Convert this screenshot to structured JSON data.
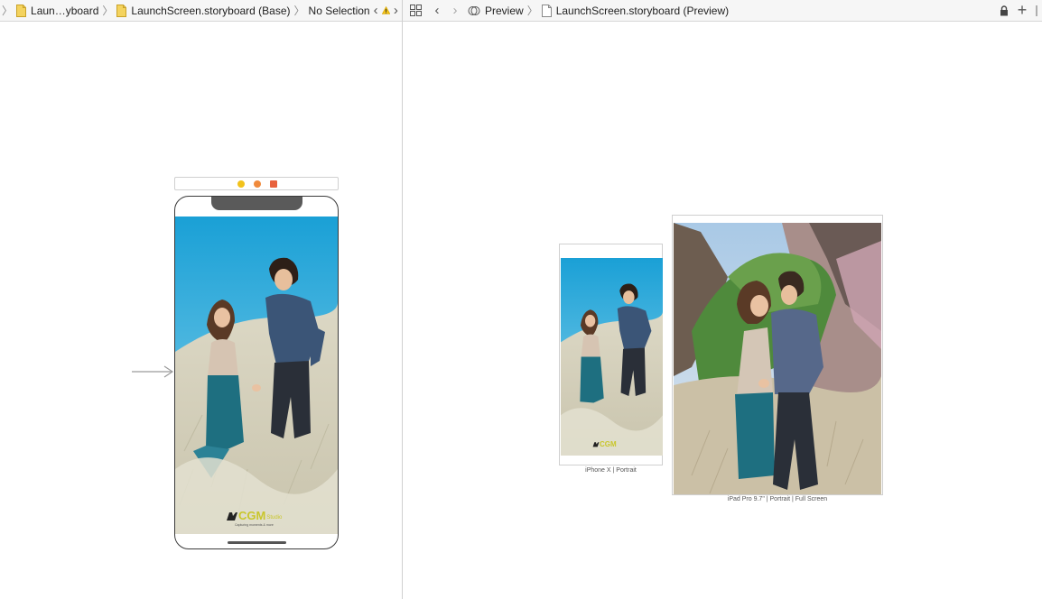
{
  "left_jumpbar": {
    "crumb1": "Laun…yboard",
    "crumb2": "LaunchScreen.storyboard (Base)",
    "crumb3": "No Selection",
    "warning_icon": "warning-triangle-icon",
    "warning_color": "#f2c21b"
  },
  "right_jumpbar": {
    "crumb1": "Preview",
    "crumb2": "LaunchScreen.storyboard (Preview)"
  },
  "storyboard": {
    "logo_main": "CGM",
    "logo_sub": "Studio",
    "logo_tag": "Capturing moments & more"
  },
  "preview": {
    "iphone_label": "iPhone X | Portrait",
    "ipad_label": "iPad Pro 9.7\" | Portrait | Full Screen"
  },
  "colors": {
    "sky": "#2aa7d8",
    "grass": "#d8d5c4",
    "dress": "#1e6f80",
    "shirt": "#3b5577",
    "logo": "#c9c62a"
  }
}
